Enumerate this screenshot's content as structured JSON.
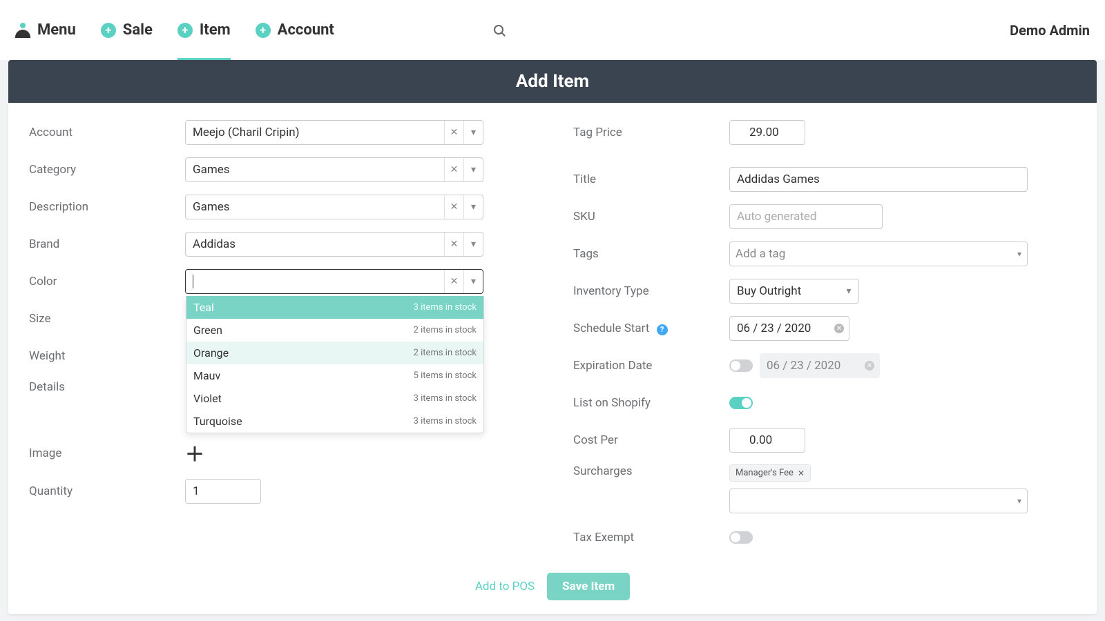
{
  "nav": {
    "items": [
      {
        "label": "Menu"
      },
      {
        "label": "Sale"
      },
      {
        "label": "Item"
      },
      {
        "label": "Account"
      }
    ],
    "user": "Demo Admin"
  },
  "page_title": "Add Item",
  "left": {
    "labels": {
      "account": "Account",
      "category": "Category",
      "description": "Description",
      "brand": "Brand",
      "color": "Color",
      "size": "Size",
      "weight": "Weight",
      "details": "Details",
      "image": "Image",
      "quantity": "Quantity"
    },
    "account_value": "Meejo (Charil Cripin)",
    "category_value": "Games",
    "description_value": "Games",
    "brand_value": "Addidas",
    "color_value": "",
    "color_options": [
      {
        "name": "Teal",
        "stock": "3 items in stock",
        "selected": true
      },
      {
        "name": "Green",
        "stock": "2 items in stock"
      },
      {
        "name": "Orange",
        "stock": "2 items in stock",
        "hover": true
      },
      {
        "name": "Mauv",
        "stock": "5 items in stock"
      },
      {
        "name": "Violet",
        "stock": "3 items in stock"
      },
      {
        "name": "Turquoise",
        "stock": "3 items in stock"
      }
    ],
    "quantity_value": "1"
  },
  "right": {
    "labels": {
      "tag_price": "Tag Price",
      "title": "Title",
      "sku": "SKU",
      "tags": "Tags",
      "inventory_type": "Inventory Type",
      "schedule_start": "Schedule Start",
      "expiration_date": "Expiration Date",
      "list_on_shopify": "List on Shopify",
      "cost_per": "Cost Per",
      "surcharges": "Surcharges",
      "tax_exempt": "Tax Exempt"
    },
    "tag_price_value": "29.00",
    "title_value": "Addidas Games",
    "sku_placeholder": "Auto generated",
    "tags_placeholder": "Add a tag",
    "inventory_type_value": "Buy Outright",
    "schedule_start_value": "06 / 23 / 2020",
    "expiration_date_value": "06 / 23 / 2020",
    "list_on_shopify_on": true,
    "cost_per_value": "0.00",
    "surcharge_chip": "Manager's Fee",
    "tax_exempt_on": false
  },
  "footer": {
    "add_to_pos": "Add to POS",
    "save_item": "Save Item"
  }
}
